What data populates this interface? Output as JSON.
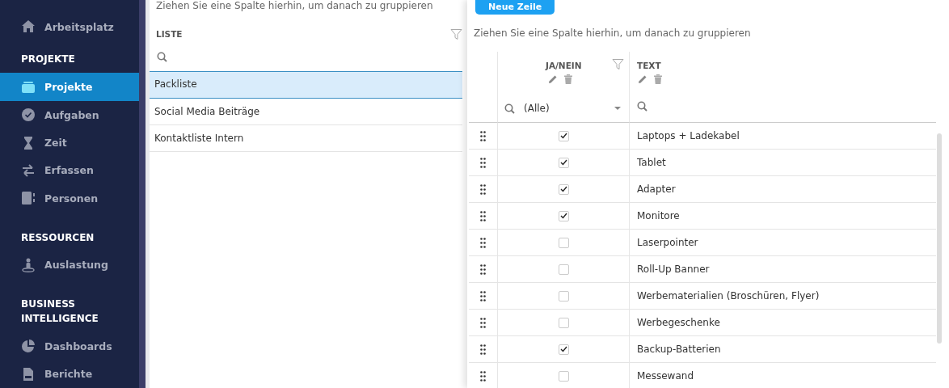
{
  "sidebar": {
    "top_item": {
      "label": "Arbeitsplatz",
      "selected": false
    },
    "sections": [
      {
        "title": "PROJEKTE",
        "items": [
          {
            "label": "Projekte",
            "selected": true
          },
          {
            "label": "Aufgaben",
            "selected": false
          },
          {
            "label": "Zeit",
            "selected": false
          },
          {
            "label": "Erfassen",
            "selected": false
          },
          {
            "label": "Personen",
            "selected": false
          }
        ]
      },
      {
        "title": "RESSOURCEN",
        "items": [
          {
            "label": "Auslastung",
            "selected": false
          }
        ]
      },
      {
        "title": "BUSINESS INTELLIGENCE",
        "items": [
          {
            "label": "Dashboards",
            "selected": false
          },
          {
            "label": "Berichte",
            "selected": false
          }
        ]
      }
    ]
  },
  "list_panel": {
    "group_hint": "Ziehen Sie eine Spalte hierhin, um danach zu gruppieren",
    "column": "LISTE",
    "rows": [
      {
        "label": "Packliste",
        "selected": true
      },
      {
        "label": "Social Media Beiträge",
        "selected": false
      },
      {
        "label": "Kontaktliste Intern",
        "selected": false
      }
    ]
  },
  "table_panel": {
    "new_button": "Neue Zeile",
    "group_hint": "Ziehen Sie eine Spalte hierhin, um danach zu gruppieren",
    "columns": [
      {
        "title": "JA/NEIN",
        "filter_value": "(Alle)"
      },
      {
        "title": "TEXT"
      }
    ],
    "rows": [
      {
        "checked": true,
        "text": "Laptops + Ladekabel"
      },
      {
        "checked": true,
        "text": "Tablet"
      },
      {
        "checked": true,
        "text": "Adapter"
      },
      {
        "checked": true,
        "text": "Monitore"
      },
      {
        "checked": false,
        "text": "Laserpointer"
      },
      {
        "checked": false,
        "text": "Roll-Up Banner"
      },
      {
        "checked": false,
        "text": "Werbematerialien (Broschüren, Flyer)"
      },
      {
        "checked": false,
        "text": "Werbegeschenke"
      },
      {
        "checked": true,
        "text": "Backup-Batterien"
      },
      {
        "checked": false,
        "text": "Messewand"
      }
    ]
  }
}
